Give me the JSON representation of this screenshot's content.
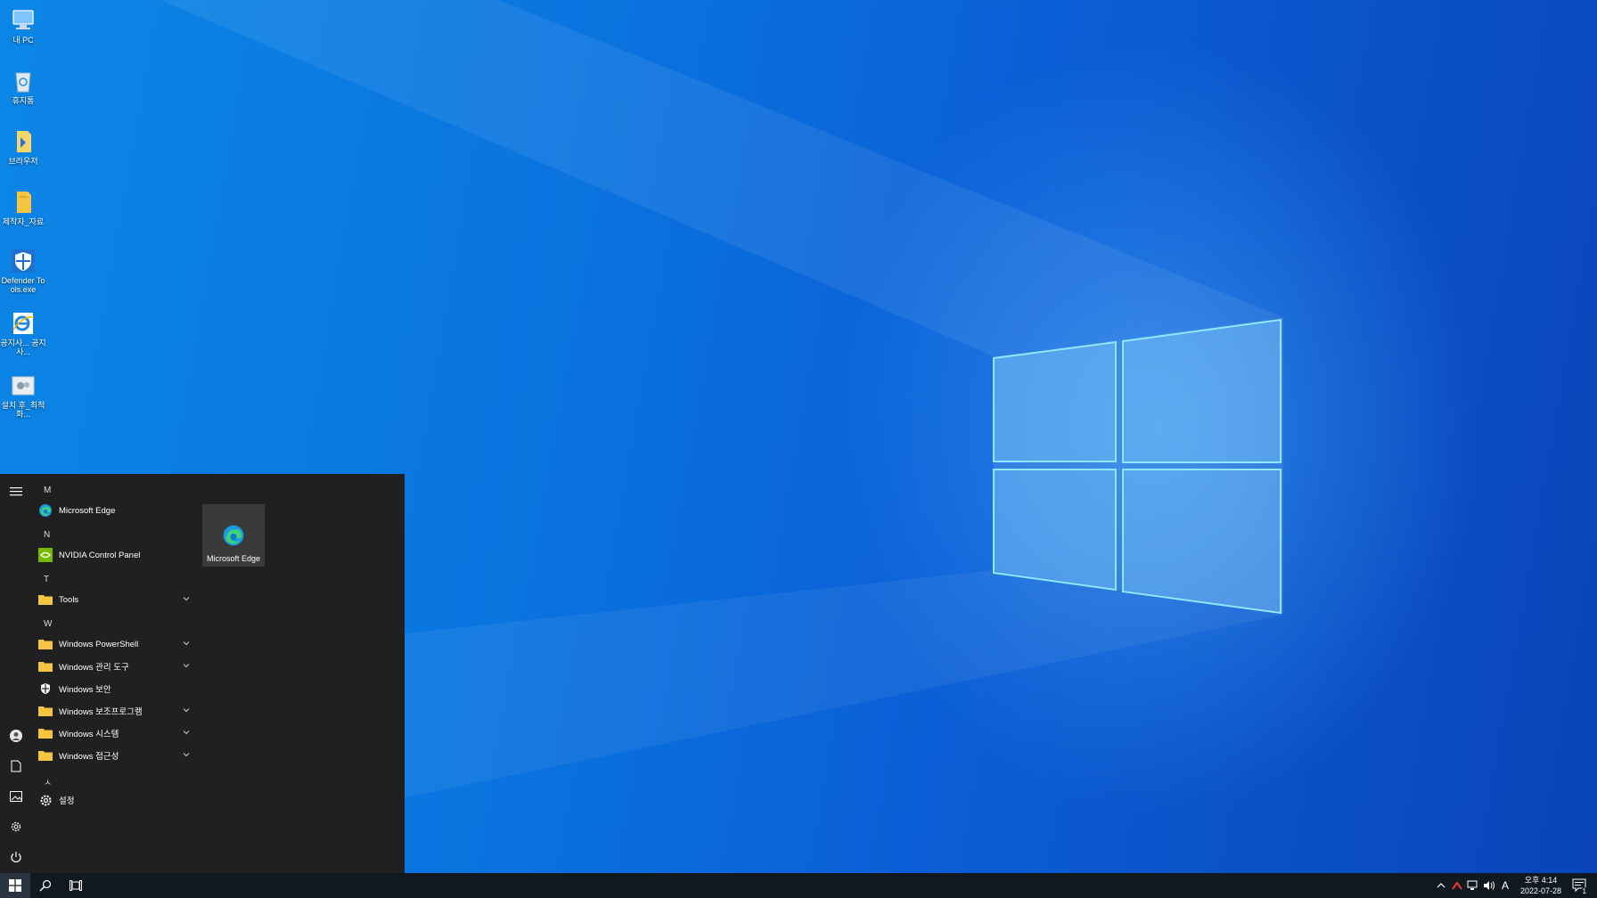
{
  "desktop": {
    "icons": [
      {
        "label": "내 PC",
        "icon": "computer-icon"
      },
      {
        "label": "휴지통",
        "icon": "recycle-bin-icon"
      },
      {
        "label": "브라우저",
        "icon": "browser-file-icon"
      },
      {
        "label": "제작자_자료",
        "icon": "folder-icon"
      },
      {
        "label": "Defender Tools.exe",
        "icon": "shield-icon"
      },
      {
        "label": "공지사... 공지사...",
        "icon": "internet-explorer-icon"
      },
      {
        "label": "설치 후_최적화...",
        "icon": "settings-gear-icon"
      }
    ]
  },
  "start_menu": {
    "letters": {
      "m": "M",
      "n": "N",
      "t": "T",
      "w": "W",
      "hangul": "ㅅ"
    },
    "apps": {
      "edge": "Microsoft Edge",
      "nvidia": "NVIDIA Control Panel",
      "tools": "Tools",
      "powershell": "Windows PowerShell",
      "admin_tools": "Windows 관리 도구",
      "security": "Windows 보안",
      "accessories": "Windows 보조프로그램",
      "system": "Windows 시스템",
      "accessibility": "Windows 접근성",
      "settings": "설정"
    },
    "tile_label": "Microsoft Edge"
  },
  "taskbar": {
    "clock_time": "오후 4:14",
    "clock_date": "2022-07-28",
    "ime": "A",
    "notification_count": "1"
  },
  "colors": {
    "start_bg": "#202020",
    "taskbar_bg": "#101820",
    "folder": "#f5c542",
    "accent": "#0a74df"
  }
}
